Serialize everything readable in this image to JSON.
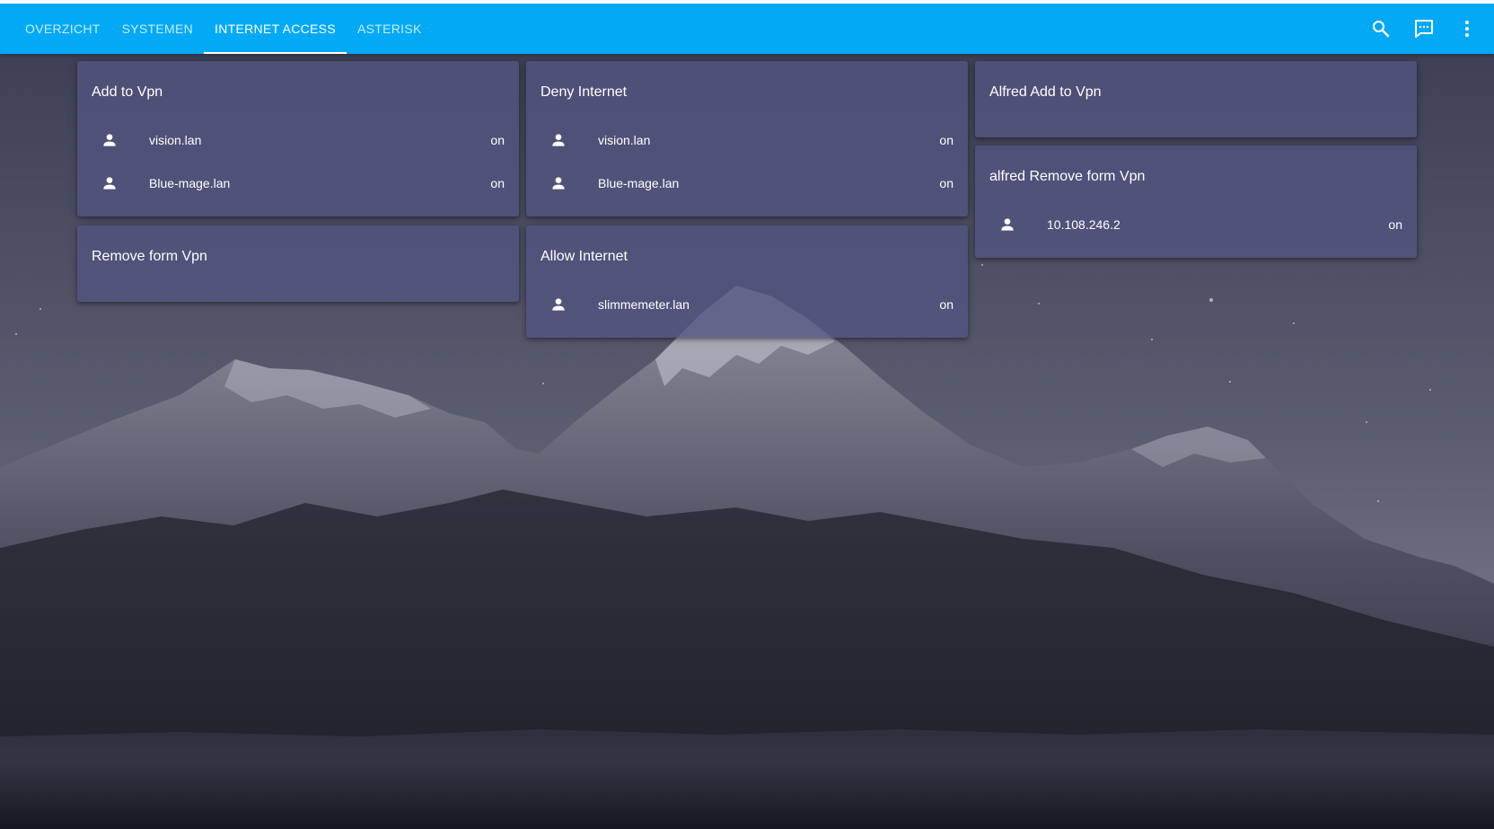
{
  "theme": {
    "header_color": "#03a9f4",
    "card_color": "rgba(82, 84, 128, 0.80)",
    "text_color": "#ffffff"
  },
  "header": {
    "tabs": [
      {
        "label": "OVERZICHT",
        "active": false
      },
      {
        "label": "SYSTEMEN",
        "active": false
      },
      {
        "label": "INTERNET ACCESS",
        "active": true
      },
      {
        "label": "ASTERISK",
        "active": false
      }
    ],
    "actions": [
      {
        "icon": "search-icon"
      },
      {
        "icon": "chat-icon"
      },
      {
        "icon": "more-vertical-icon"
      }
    ]
  },
  "cards": {
    "add_to_vpn": {
      "title": "Add to Vpn",
      "rows": [
        {
          "icon": "person-icon",
          "name": "vision.lan",
          "state": "on"
        },
        {
          "icon": "person-icon",
          "name": "Blue-mage.lan",
          "state": "on"
        }
      ]
    },
    "remove_from_vpn": {
      "title": "Remove form Vpn",
      "rows": []
    },
    "deny_internet": {
      "title": "Deny Internet",
      "rows": [
        {
          "icon": "person-icon",
          "name": "vision.lan",
          "state": "on"
        },
        {
          "icon": "person-icon",
          "name": "Blue-mage.lan",
          "state": "on"
        }
      ]
    },
    "allow_internet": {
      "title": "Allow Internet",
      "rows": [
        {
          "icon": "person-icon",
          "name": "slimmemeter.lan",
          "state": "on"
        }
      ]
    },
    "alfred_add_to_vpn": {
      "title": "Alfred Add to Vpn",
      "rows": []
    },
    "alfred_remove_from_vpn": {
      "title": "alfred Remove form Vpn",
      "rows": [
        {
          "icon": "person-icon",
          "name": "10.108.246.2",
          "state": "on"
        }
      ]
    }
  }
}
